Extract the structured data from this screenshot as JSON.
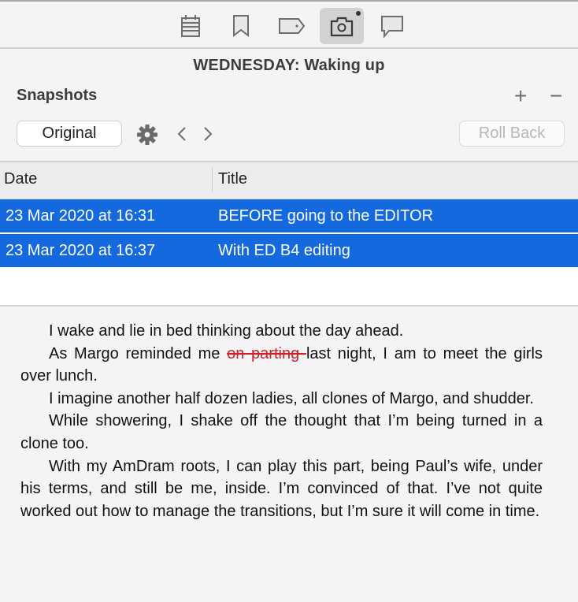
{
  "toolbar": {
    "tabs": [
      {
        "icon": "notepad-icon",
        "active": false
      },
      {
        "icon": "bookmark-icon",
        "active": false
      },
      {
        "icon": "tag-icon",
        "active": false
      },
      {
        "icon": "camera-icon",
        "active": true,
        "badge": true
      },
      {
        "icon": "comment-icon",
        "active": false
      }
    ]
  },
  "document": {
    "title": "WEDNESDAY: Waking up"
  },
  "snapshots": {
    "label": "Snapshots",
    "add_symbol": "+",
    "remove_symbol": "−",
    "original_label": "Original",
    "prev_symbol": "‹",
    "next_symbol": "›",
    "rollback_label": "Roll Back",
    "columns": [
      "Date",
      "Title"
    ],
    "rows": [
      {
        "date": "23 Mar 2020 at 16:31",
        "title": "BEFORE going to the EDITOR",
        "selected": true
      },
      {
        "date": "23 Mar 2020 at 16:37",
        "title": "With ED B4 editing",
        "selected": true
      }
    ],
    "selection_color": "#1469de"
  },
  "editor": {
    "p1": "I wake and lie in bed thinking about the day ahead.",
    "p2_before": "As Margo reminded me ",
    "p2_deleted": "on parting ",
    "p2_after": "last night, I am to meet the girls over lunch.",
    "p3": "I imagine another half dozen ladies, all clones of Margo, and shudder.",
    "p4": "While showering, I shake off the thought that I’m being turned in a clone too.",
    "p5": "With my AmDram roots, I can play this part, being Paul’s wife, under his terms, and still be me, inside. I’m convinced of that. I’ve not quite worked out how to manage the transitions, but I’m sure it will come in time.",
    "deletion_color": "#d01f2a"
  }
}
